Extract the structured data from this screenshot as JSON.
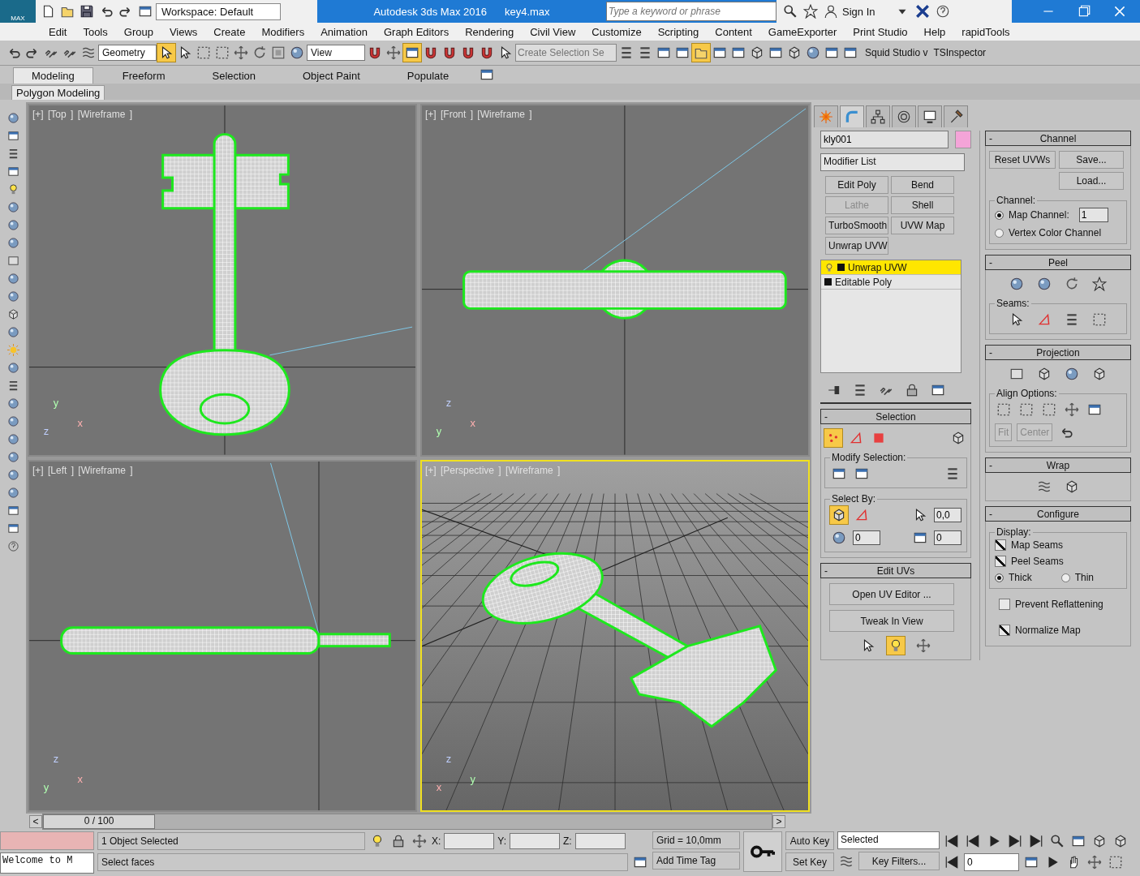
{
  "title_bar": {
    "logo": "MAX",
    "workspace": "Workspace: Default",
    "app_title": "Autodesk 3ds Max 2016",
    "file_name": "key4.max",
    "search_placeholder": "Type a keyword or phrase",
    "sign_in": "Sign In"
  },
  "menu": [
    "Edit",
    "Tools",
    "Group",
    "Views",
    "Create",
    "Modifiers",
    "Animation",
    "Graph Editors",
    "Rendering",
    "Civil View",
    "Customize",
    "Scripting",
    "Content",
    "GameExporter",
    "Print Studio",
    "Help",
    "rapidTools"
  ],
  "main_toolbar": {
    "selection_filter": "Geometry",
    "reference_coordinate": "View",
    "named_selection_placeholder": "Create Selection Se",
    "plugins": [
      "Squid Studio v",
      "TSInspector"
    ],
    "tools": [
      {
        "kind": "undo",
        "selected": false
      },
      {
        "kind": "redo",
        "selected": false
      },
      {
        "kind": "link",
        "selected": false
      },
      {
        "kind": "link",
        "selected": false
      },
      {
        "kind": "wave",
        "selected": false
      },
      {
        "kind": "cursor",
        "selected": true
      },
      {
        "kind": "cursor",
        "selected": false
      },
      {
        "kind": "dashed-square",
        "selected": false
      },
      {
        "kind": "dashed-square",
        "selected": false
      },
      {
        "kind": "cross-arrows",
        "selected": false
      },
      {
        "kind": "rotate",
        "selected": false
      },
      {
        "kind": "scale",
        "selected": false
      },
      {
        "kind": "sphere",
        "selected": false
      }
    ],
    "tools_2": [
      {
        "kind": "magnet",
        "selected": false
      },
      {
        "kind": "cross-arrows",
        "selected": false
      },
      {
        "kind": "window",
        "selected": true
      },
      {
        "kind": "magnet",
        "selected": false
      },
      {
        "kind": "magnet",
        "selected": false
      },
      {
        "kind": "magnet",
        "selected": false
      },
      {
        "kind": "magnet",
        "selected": false
      },
      {
        "kind": "cursor",
        "selected": false
      }
    ],
    "tools_3": [
      {
        "kind": "bars",
        "selected": false
      },
      {
        "kind": "bars",
        "selected": false
      },
      {
        "kind": "window",
        "selected": false
      },
      {
        "kind": "window",
        "selected": false
      },
      {
        "kind": "folder",
        "selected": true
      },
      {
        "kind": "window",
        "selected": false
      },
      {
        "kind": "window",
        "selected": false
      },
      {
        "kind": "cube",
        "selected": false
      },
      {
        "kind": "window",
        "selected": false
      },
      {
        "kind": "cube",
        "selected": false
      },
      {
        "kind": "sphere",
        "selected": false
      },
      {
        "kind": "window",
        "selected": false
      },
      {
        "kind": "window",
        "selected": false
      }
    ]
  },
  "ribbon": {
    "tabs": [
      {
        "label": "Modeling",
        "selected": true
      },
      {
        "label": "Freeform",
        "selected": false
      },
      {
        "label": "Selection",
        "selected": false
      },
      {
        "label": "Object Paint",
        "selected": false
      },
      {
        "label": "Populate",
        "selected": false
      }
    ],
    "panel": "Polygon Modeling"
  },
  "viewports": [
    {
      "label": "[+] [Top ] [Wireframe ]",
      "kind": "top",
      "active": false,
      "axes": [
        "y",
        "z",
        "x"
      ]
    },
    {
      "label": "[+] [Front ] [Wireframe ]",
      "kind": "front",
      "active": false,
      "axes": [
        "z",
        "y",
        "x"
      ]
    },
    {
      "label": "[+] [Left ] [Wireframe ]",
      "kind": "left",
      "active": false,
      "axes": [
        "z",
        "y",
        "x"
      ]
    },
    {
      "label": "[+] [Perspective ] [Wireframe ]",
      "kind": "perspective",
      "active": true,
      "axes": [
        "z",
        "x",
        "y"
      ]
    }
  ],
  "command_panel": {
    "tabs": [
      {
        "kind": "create",
        "selected": false
      },
      {
        "kind": "modify",
        "selected": true
      },
      {
        "kind": "hierarchy",
        "selected": false
      },
      {
        "kind": "motion",
        "selected": false
      },
      {
        "kind": "display",
        "selected": false
      },
      {
        "kind": "utilities",
        "selected": false
      }
    ],
    "object": {
      "name": "kly001",
      "color": "#f4a4d8"
    },
    "modifier_list": "Modifier List",
    "modifier_buttons": [
      {
        "label": "Edit Poly",
        "disabled": false
      },
      {
        "label": "Bend",
        "disabled": false
      },
      {
        "label": "Lathe",
        "disabled": true
      },
      {
        "label": "Shell",
        "disabled": false
      },
      {
        "label": "TurboSmooth",
        "disabled": false
      },
      {
        "label": "UVW Map",
        "disabled": false
      },
      {
        "label": "Unwrap UVW",
        "disabled": false
      }
    ],
    "stack": [
      {
        "label": "Unwrap UVW",
        "kind": "modifier",
        "selected": true
      },
      {
        "label": "Editable Poly",
        "kind": "object",
        "selected": false
      }
    ],
    "selection": {
      "sign": "-",
      "title": "Selection",
      "subobjects": [
        {
          "kind": "vertex",
          "selected": true
        },
        {
          "kind": "edge",
          "selected": false
        },
        {
          "kind": "polygon",
          "selected": false
        }
      ],
      "modify_label": "Modify Selection:",
      "select_by_label": "Select By:",
      "by_element": true,
      "angle": "0,0",
      "spinner_a": "0",
      "spinner_b": "0"
    },
    "edit_uvs": {
      "sign": "-",
      "title": "Edit UVs",
      "buttons": [
        "Open UV Editor ...",
        "Tweak In View"
      ],
      "tweak_active": true
    },
    "channel": {
      "sign": "-",
      "title": "Channel",
      "buttons": [
        "Reset UVWs",
        "Save...",
        "Load..."
      ],
      "group": "Channel:",
      "options": [
        {
          "label": "Map Channel:",
          "selected": true
        },
        {
          "label": "Vertex Color Channel",
          "selected": false
        }
      ],
      "map_channel": "1"
    },
    "peel": {
      "sign": "-",
      "title": "Peel",
      "seams_label": "Seams:"
    },
    "projection": {
      "sign": "-",
      "title": "Projection",
      "align_label": "Align Options:",
      "buttons": [
        {
          "label": "Fit",
          "disabled": true
        },
        {
          "label": "Center",
          "disabled": true
        }
      ]
    },
    "wrap": {
      "sign": "-",
      "title": "Wrap"
    },
    "configure": {
      "sign": "-",
      "title": "Configure",
      "display_label": "Display:",
      "display": [
        {
          "label": "Map Seams",
          "checked": true
        },
        {
          "label": "Peel Seams",
          "checked": true
        }
      ],
      "thickness": [
        {
          "label": "Thick",
          "selected": true
        },
        {
          "label": "Thin",
          "selected": false
        }
      ],
      "options": [
        {
          "label": "Prevent Reflattening",
          "checked": false
        },
        {
          "label": "Normalize Map",
          "checked": true
        }
      ]
    }
  },
  "time_slider": {
    "frame": "0 / 100",
    "prev": "<",
    "next": ">",
    "level": 0
  },
  "status": {
    "welcome": "Welcome to M",
    "selection": "1 Object Selected",
    "hint": "Select faces",
    "x_label": "X:",
    "y_label": "Y:",
    "z_label": "Z:",
    "grid": "Grid = 10,0mm",
    "time_tag": "Add Time Tag",
    "auto_key": "Auto Key",
    "set_key": "Set Key",
    "key_mode": "Selected",
    "key_filters": "Key Filters...",
    "current_frame": "0"
  }
}
